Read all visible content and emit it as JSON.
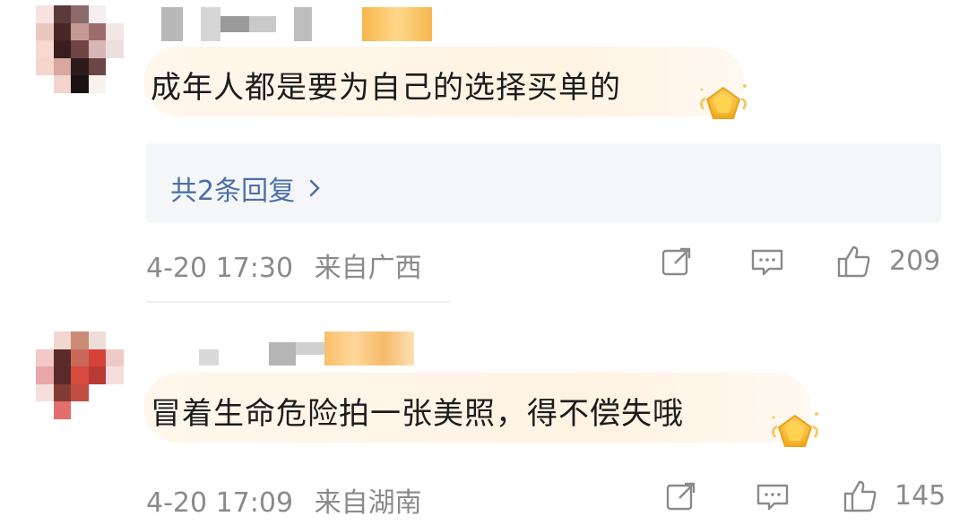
{
  "comments": [
    {
      "text": "成年人都是要为自己的选择买单的",
      "reply_count_label": "共2条回复",
      "timestamp": "4-20 17:30",
      "location": "来自广西",
      "likes": "209",
      "avatar_pixels": [
        "#f5e2e1",
        "#5a3a3a",
        "#8b6a6a",
        "#f4eeee",
        "#ffffff",
        "#e9c7c0",
        "#4b2626",
        "#c39a96",
        "#9c6b6b",
        "#f3e6e6",
        "#f7d9cf",
        "#3a1e1e",
        "#704444",
        "#d6b7b5",
        "#ece0de",
        "#f5d6cd",
        "#d7a7a0",
        "#2b1a1a",
        "#6a4646",
        "#ffffff",
        "#ffffff",
        "#f2d4cc",
        "#1c1212",
        "#faf2f0",
        "#ffffff"
      ],
      "badge_icon": "gold-pentagon-badge-icon"
    },
    {
      "text": "冒着生命危险拍一张美照，得不偿失哦",
      "timestamp": "4-20 17:09",
      "location": "来自湖南",
      "likes": "145",
      "avatar_pixels": [
        "#ffffff",
        "#f0d7d0",
        "#c98b75",
        "#eedcd7",
        "#ffffff",
        "#f1c9c6",
        "#5b2b2b",
        "#c9685a",
        "#d5423a",
        "#efc9c5",
        "#e9a6a6",
        "#5a2a2a",
        "#d74a3e",
        "#b83a35",
        "#f6dede",
        "#f7dede",
        "#823c34",
        "#c14c40",
        "#ffffff",
        "#ffffff",
        "#ffffff",
        "#e36e6e",
        "#ffffff",
        "#ffffff",
        "#ffffff"
      ],
      "badge_icon": "gold-pentagon-badge-icon"
    }
  ],
  "icons": {
    "share": "share-icon",
    "comment": "comment-icon",
    "like": "thumbs-up-icon",
    "chevron": "chevron-right-icon"
  },
  "colors": {
    "link": "#4a6fa8",
    "meta": "#8a8a8a",
    "bubble": "#fff5e8",
    "reply_bg": "#f5f6f8"
  }
}
